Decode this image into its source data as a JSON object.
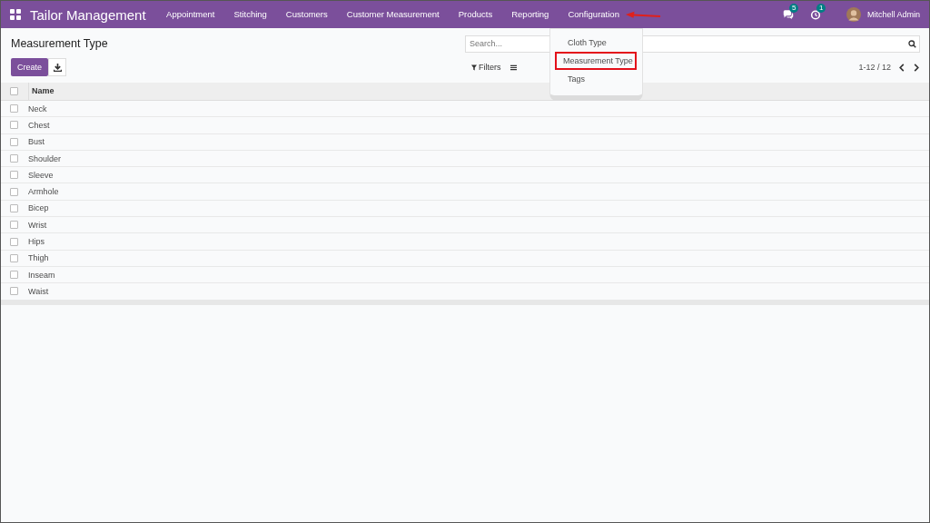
{
  "navbar": {
    "app_name": "Tailor Management",
    "menu": [
      {
        "label": "Appointment",
        "open": false
      },
      {
        "label": "Stitching",
        "open": false
      },
      {
        "label": "Customers",
        "open": false
      },
      {
        "label": "Customer Measurement",
        "open": false
      },
      {
        "label": "Products",
        "open": false
      },
      {
        "label": "Reporting",
        "open": false
      },
      {
        "label": "Configuration",
        "open": true
      }
    ],
    "messages_badge": "5",
    "activities_badge": "1",
    "user": "Mitchell Admin"
  },
  "dropdown": [
    {
      "label": "Cloth Type",
      "highlighted": false
    },
    {
      "label": "Measurement Type",
      "highlighted": true
    },
    {
      "label": "Tags",
      "highlighted": false
    }
  ],
  "page": {
    "title": "Measurement Type",
    "create_button": "Create",
    "filters_button": "Filters",
    "search": {
      "placeholder": "Search..."
    },
    "pager": "1-12 / 12"
  },
  "table": {
    "columns": [
      "Name"
    ],
    "header_checked": false,
    "rows": [
      {
        "name": "Neck",
        "checked": false
      },
      {
        "name": "Chest",
        "checked": false
      },
      {
        "name": "Bust",
        "checked": false
      },
      {
        "name": "Shoulder",
        "checked": false
      },
      {
        "name": "Sleeve",
        "checked": false
      },
      {
        "name": "Armhole",
        "checked": false
      },
      {
        "name": "Bicep",
        "checked": false
      },
      {
        "name": "Wrist",
        "checked": false
      },
      {
        "name": "Hips",
        "checked": false
      },
      {
        "name": "Thigh",
        "checked": false
      },
      {
        "name": "Inseam",
        "checked": false
      },
      {
        "name": "Waist",
        "checked": false
      }
    ]
  }
}
